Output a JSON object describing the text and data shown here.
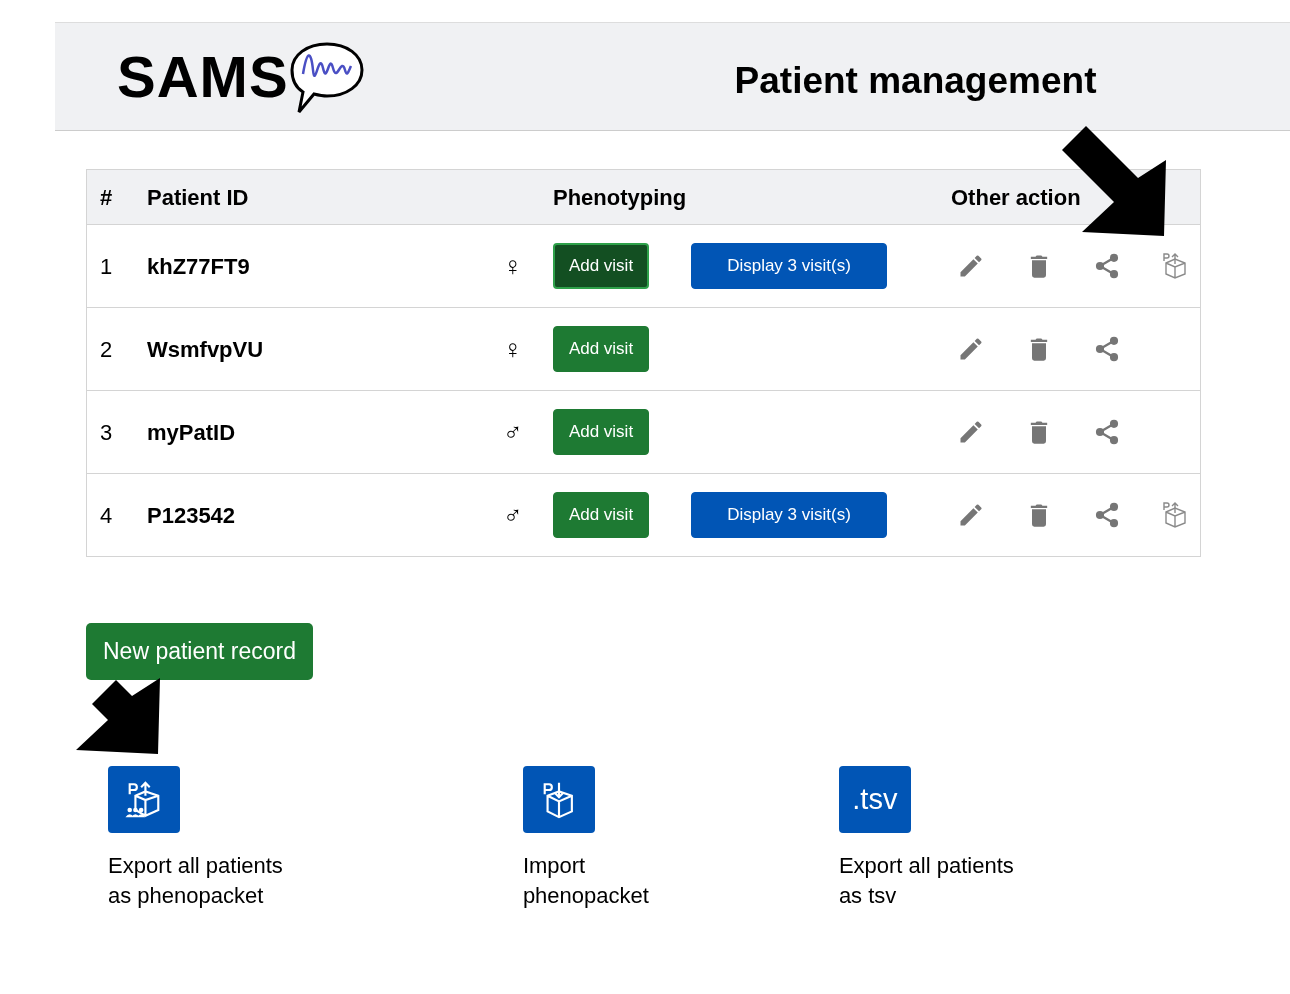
{
  "header": {
    "logo": "SAMS",
    "title": "Patient management"
  },
  "table": {
    "columns": [
      "#",
      "Patient ID",
      "Phenotyping",
      "Other action"
    ],
    "rows": [
      {
        "number": "1",
        "patient_id": "khZ77FT9",
        "sex_symbol": "♀",
        "add_visit": {
          "label": "Add visit",
          "active": true
        },
        "display_visits": "Display 3 visit(s)",
        "export_phenopacket": true
      },
      {
        "number": "2",
        "patient_id": "WsmfvpVU",
        "sex_symbol": "♀",
        "add_visit": {
          "label": "Add visit",
          "active": false
        },
        "export_phenopacket": false
      },
      {
        "number": "3",
        "patient_id": "myPatID",
        "sex_symbol": "♂",
        "add_visit": {
          "label": "Add visit",
          "active": false
        },
        "export_phenopacket": false
      },
      {
        "number": "4",
        "patient_id": "P123542",
        "sex_symbol": "♂",
        "add_visit": {
          "label": "Add visit",
          "active": false
        },
        "display_visits": "Display 3 visit(s)",
        "export_phenopacket": true
      }
    ]
  },
  "new_patient_button": "New patient record",
  "tiles": [
    {
      "kind": "export",
      "caption": [
        "Export all patients",
        "as phenopacket"
      ]
    },
    {
      "kind": "import",
      "caption": [
        "Import",
        "phenopacket"
      ]
    },
    {
      "kind": "tsv",
      "label": ".tsv",
      "caption": [
        "Export all patients",
        "as tsv"
      ]
    }
  ]
}
